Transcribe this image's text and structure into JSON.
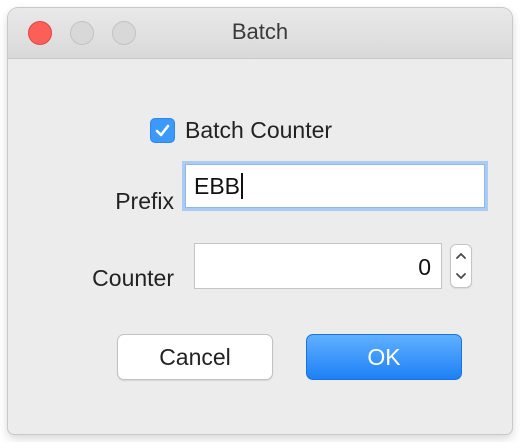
{
  "window": {
    "title": "Batch"
  },
  "form": {
    "batch_counter": {
      "label": "Batch Counter",
      "checked": true
    },
    "prefix": {
      "label": "Prefix",
      "value": "EBB"
    },
    "counter": {
      "label": "Counter",
      "value": "0"
    }
  },
  "buttons": {
    "cancel_label": "Cancel",
    "ok_label": "OK"
  },
  "colors": {
    "accent": "#3b99fc",
    "close_button": "#fc5f57",
    "window_background": "#ececec"
  },
  "icons": {
    "checkbox": "checkmark-icon",
    "stepper_up": "chevron-up-icon",
    "stepper_down": "chevron-down-icon"
  }
}
